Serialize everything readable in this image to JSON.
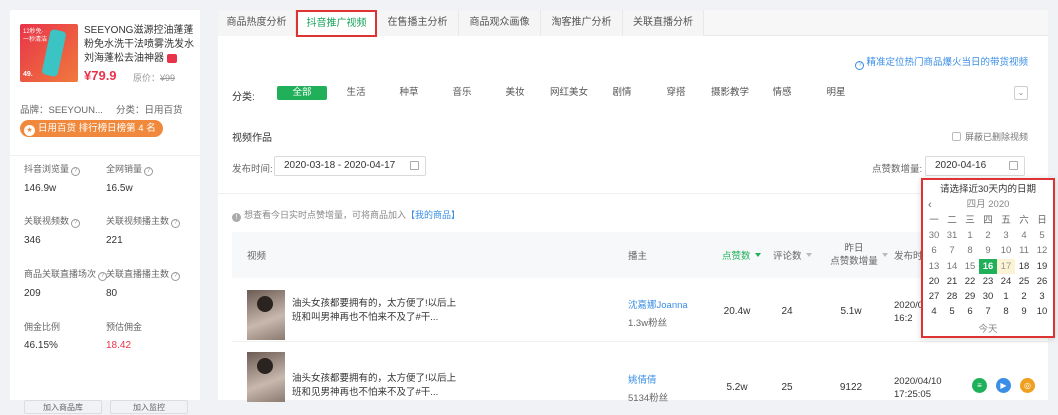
{
  "product": {
    "image_tag": "12秒免·一秒清洁",
    "image_price": "49.",
    "name": "SEEYONG滋源控油蓬蓬粉免水洗干法喷雾洗发水刘海蓬松去油神器",
    "price": "¥79.9",
    "original_price_label": "原价：",
    "original_price": "¥99",
    "brand": "品牌：SEEYOUN...",
    "category": "分类：日用百货",
    "rank": "日用百货 排行榜日榜第 4 名"
  },
  "stats": [
    {
      "label": "抖音浏览量",
      "value": "146.9w"
    },
    {
      "label": "全网销量",
      "value": "16.5w"
    },
    {
      "label": "关联视频数",
      "value": "346"
    },
    {
      "label": "关联视频播主数",
      "value": "221"
    },
    {
      "label": "商品关联直播场次",
      "value": "209"
    },
    {
      "label": "关联直播播主数",
      "value": "80"
    },
    {
      "label": "佣金比例",
      "value": "46.15%"
    },
    {
      "label": "预估佣金",
      "value": "18.42"
    }
  ],
  "left_buttons": [
    "加入商品库",
    "加入监控"
  ],
  "tabs": [
    "商品热度分析",
    "抖音推广视频",
    "在售播主分析",
    "商品观众画像",
    "淘客推广分析",
    "关联直播分析"
  ],
  "help_link": "精准定位热门商品爆火当日的带货视频",
  "filters": {
    "label": "分类:",
    "categories": [
      "全部",
      "生活",
      "种草",
      "音乐",
      "美妆",
      "网红美女",
      "剧情",
      "穿搭",
      "摄影教学",
      "情感",
      "明星"
    ],
    "expand": "⌄"
  },
  "section_title": "视频作品",
  "hide_deleted": "屏蔽已删除视频",
  "publish_label": "发布时间:",
  "publish_range": "2020-03-18 - 2020-04-17",
  "like_inc_label": "点赞数增量:",
  "like_inc_date": "2020-04-16",
  "tip": {
    "text": "想查看今日实时点赞增量，可将商品加入",
    "link": "【我的商品】"
  },
  "table": {
    "headers": [
      "视频",
      "播主",
      "点赞数",
      "评论数",
      "昨日\n点赞数增量",
      "发布时"
    ],
    "rows": [
      {
        "title": "油头女孩都要拥有的，太方便了!以后上班和叫男神再也不怕来不及了#干...",
        "author": "沈嘉娜Joanna",
        "fans": "1.3w粉丝",
        "likes": "20.4w",
        "comments": "24",
        "inc": "5.1w",
        "time": "2020/0\n16:2"
      },
      {
        "title": "油头女孩都要拥有的，太方便了!以后上班和见男神再也不怕来不及了#干...",
        "author": "姚倩倩",
        "fans": "5134粉丝",
        "likes": "5.2w",
        "comments": "25",
        "inc": "9122",
        "time": "2020/04/10\n17:25:05"
      }
    ]
  },
  "calendar": {
    "header": "请选择近30天内的日期",
    "prev": "‹",
    "month": "四月 2020",
    "weekdays": [
      "一",
      "二",
      "三",
      "四",
      "五",
      "六",
      "日"
    ],
    "weeks": [
      [
        "30",
        "31",
        "1",
        "2",
        "3",
        "4",
        "5"
      ],
      [
        "6",
        "7",
        "8",
        "9",
        "10",
        "11",
        "12"
      ],
      [
        "13",
        "14",
        "15",
        "16",
        "17",
        "18",
        "19"
      ],
      [
        "20",
        "21",
        "22",
        "23",
        "24",
        "25",
        "26"
      ],
      [
        "27",
        "28",
        "29",
        "30",
        "1",
        "2",
        "3"
      ],
      [
        "4",
        "5",
        "6",
        "7",
        "8",
        "9",
        "10"
      ]
    ],
    "footer": "今天"
  },
  "colors": {
    "accent": "#20b05a",
    "link": "#3a8ee6",
    "price": "#e8334a",
    "highlight_border": "#dd3333"
  }
}
